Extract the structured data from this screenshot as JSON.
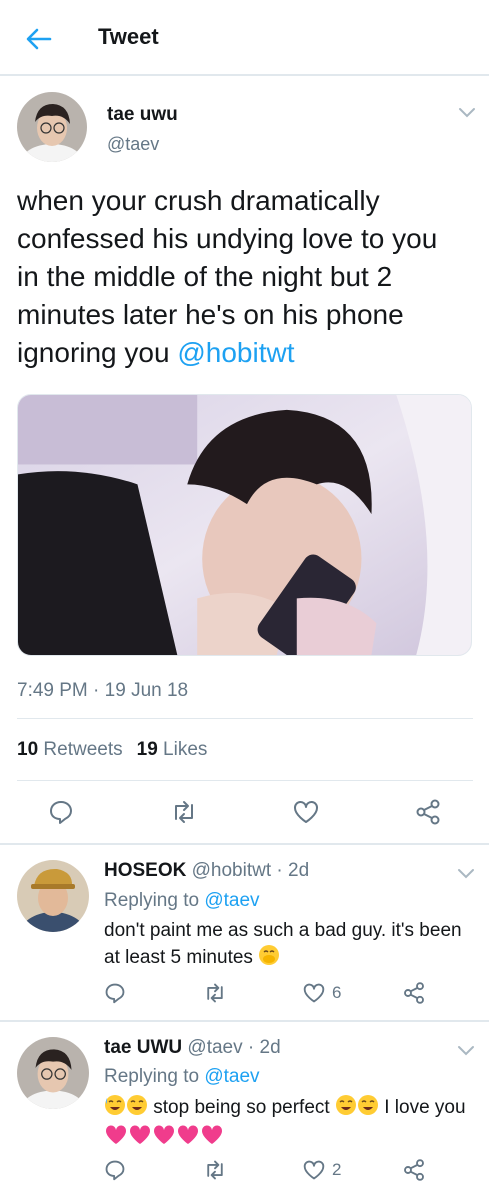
{
  "header": {
    "title": "Tweet"
  },
  "tweet": {
    "name": "tae uwu",
    "handle": "@taev",
    "text_lines": [
      "when your crush dramatically",
      "confessed his undying love to you",
      "in the middle of the night but 2",
      "minutes later he's on his phone",
      "ignoring you"
    ],
    "mention": "@hobitwt",
    "time": "7:49 PM",
    "date": "19 Jun 18",
    "retweets_count": "10",
    "retweets_label": "Retweets",
    "likes_count": "19",
    "likes_label": "Likes"
  },
  "replies": [
    {
      "name": "HOSEOK",
      "handle": "@hobitwt",
      "age": "2d",
      "replying_prefix": "Replying to",
      "replying_to": "@taev",
      "text": "don't paint me as such a bad guy. it's been at least 5 minutes",
      "likes": "6"
    },
    {
      "name": "tae UWU",
      "handle": "@taev",
      "age": "2d",
      "replying_prefix": "Replying to",
      "replying_to": "@taev",
      "text_part1": "stop being so perfect",
      "text_part2": "I love you",
      "likes": "2"
    }
  ],
  "colors": {
    "accent": "#1da1f2",
    "muted": "#657786",
    "border": "#e1e8ed",
    "text": "#14171a"
  },
  "icons": [
    "back-arrow-icon",
    "chevron-down-icon",
    "reply-icon",
    "retweet-icon",
    "like-icon",
    "share-icon",
    "sweat-smile-emoji",
    "hand-over-mouth-emoji",
    "heart-ribbon-emoji"
  ]
}
